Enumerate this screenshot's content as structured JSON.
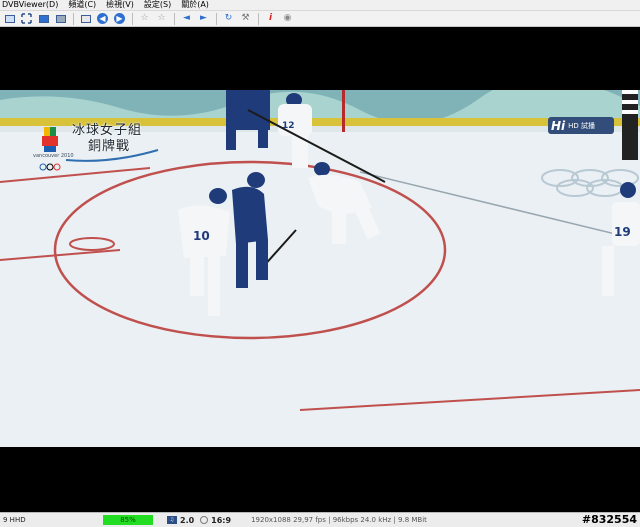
{
  "menu": [
    {
      "label": "DVBViewer(D)"
    },
    {
      "label": "頻道(C)"
    },
    {
      "label": "檢視(V)"
    },
    {
      "label": "設定(S)"
    },
    {
      "label": "關於(A)"
    }
  ],
  "toolbar": {
    "buttons": [
      {
        "icon": "window-mode-icon"
      },
      {
        "icon": "fullscreen-icon"
      },
      {
        "icon": "desktop-mode-icon"
      },
      {
        "icon": "video-frame-icon"
      },
      {
        "icon": "osd-icon"
      },
      {
        "icon": "previous-channel-icon"
      },
      {
        "icon": "next-channel-icon"
      },
      {
        "icon": "favorite-star-icon"
      },
      {
        "icon": "favorite-star-outline-icon"
      },
      {
        "icon": "volume-down-icon"
      },
      {
        "icon": "volume-up-icon"
      },
      {
        "icon": "refresh-icon"
      },
      {
        "icon": "tools-icon"
      },
      {
        "icon": "info-icon"
      },
      {
        "icon": "record-icon"
      }
    ]
  },
  "video": {
    "overlay_line1": "冰球女子組",
    "overlay_line2": "銅牌戰",
    "olympic_logo_text": "vancouver 2010",
    "channel_logo_main": "Hi",
    "channel_logo_sub": "HD 試播",
    "player_numbers": [
      "12",
      "10",
      "19"
    ]
  },
  "status": {
    "channel": "9 HHD",
    "signal": "85%",
    "signal_level": 0.85,
    "audio": "2.0",
    "aspect": "16:9",
    "stream_info": "1920x1088 29,97 fps | 96kbps 24.0 kHz | 9.8 MBit",
    "tag": "#832554"
  },
  "colors": {
    "signal_bar": "#22dd22",
    "ice": "#e9eef2",
    "line_red": "#c0504d",
    "jersey_white": "#f4f6f8",
    "jersey_blue": "#1f3b7a"
  }
}
